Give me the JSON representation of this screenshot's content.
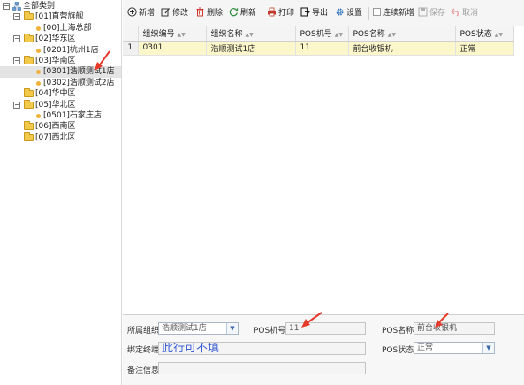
{
  "tree": {
    "root": "全部类别",
    "nodes": [
      {
        "label": "[01]直营旗舰"
      },
      {
        "label": "[00]上海总部"
      },
      {
        "label": "[02]华东区"
      },
      {
        "label": "[0201]杭州1店"
      },
      {
        "label": "[03]华南区"
      },
      {
        "label": "[0301]浩顺测试1店"
      },
      {
        "label": "[0302]浩顺测试2店"
      },
      {
        "label": "[04]华中区"
      },
      {
        "label": "[05]华北区"
      },
      {
        "label": "[0501]石家庄店"
      },
      {
        "label": "[06]西南区"
      },
      {
        "label": "[07]西北区"
      }
    ],
    "expand_glyphs": {
      "open": "−",
      "closed": "+"
    }
  },
  "toolbar": {
    "add": "新增",
    "edit": "修改",
    "delete": "删除",
    "refresh": "刷新",
    "print": "打印",
    "export": "导出",
    "settings": "设置",
    "continuous_add": "连续新增",
    "save": "保存",
    "cancel": "取消"
  },
  "grid": {
    "columns": [
      "组织编号",
      "组织名称",
      "POS机号",
      "POS名称",
      "POS状态"
    ],
    "rows": [
      {
        "num": "1",
        "cells": [
          "0301",
          "浩顺测试1店",
          "11",
          "前台收银机",
          "正常"
        ]
      }
    ]
  },
  "form": {
    "org_label": "所属组织",
    "org_value": "浩顺测试1店",
    "pos_no_label": "POS机号",
    "pos_no_value": "11",
    "pos_name_label": "POS名称",
    "pos_name_value": "前台收银机",
    "bind_label": "绑定终端",
    "bind_value": "此行可不填",
    "status_label": "POS状态",
    "status_value": "正常",
    "remark_label": "备注信息",
    "remark_value": ""
  },
  "colors": {
    "selected_row": "#fcf6cb",
    "folder": "#f3c94c",
    "annotation_arrow": "#e53a2a",
    "bind_text": "#3b5fd6"
  },
  "icons": {
    "add": "plus-circle-icon",
    "edit": "edit-icon",
    "delete": "trash-icon",
    "refresh": "refresh-icon",
    "print": "printer-icon",
    "export": "export-icon",
    "settings": "gear-icon",
    "save": "save-icon",
    "cancel": "undo-icon"
  }
}
